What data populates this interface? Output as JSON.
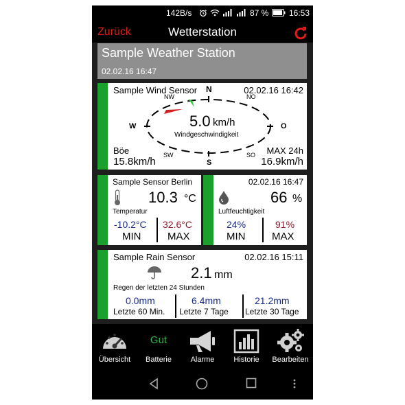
{
  "status_bar": {
    "net_speed": "142B/s",
    "battery_pct": "87 %",
    "time": "16:53"
  },
  "header": {
    "back_label": "Zurück",
    "title": "Wetterstation"
  },
  "station": {
    "name": "Sample Weather Station",
    "date": "02.02.16 16:47"
  },
  "wind": {
    "sensor_name": "Sample Wind Sensor",
    "timestamp": "02.02.16 16:42",
    "compass": {
      "n": "N",
      "ne": "NO",
      "e": "O",
      "se": "SO",
      "s": "S",
      "sw": "SW",
      "w": "W",
      "nw": "NW"
    },
    "speed_value": "5.0",
    "speed_unit": "km/h",
    "speed_label": "Windgeschwindigkeit",
    "gust_label": "Böe",
    "gust_value": "15.8km/h",
    "max_label": "MAX 24h",
    "max_value": "16.9km/h"
  },
  "temperature": {
    "sensor_name": "Sample Sensor Berlin",
    "value": "10.3",
    "unit": "°C",
    "label": "Temperatur",
    "min_value": "-10.2°C",
    "min_label": "MIN",
    "max_value": "32.6°C",
    "max_label": "MAX"
  },
  "humidity": {
    "timestamp": "02.02.16 16:47",
    "value": "66",
    "unit": "%",
    "label": "Luftfeuchtigkeit",
    "min_value": "24%",
    "min_label": "MIN",
    "max_value": "91%",
    "max_label": "MAX"
  },
  "rain": {
    "sensor_name": "Sample Rain Sensor",
    "timestamp": "02.02.16 15:11",
    "value": "2.1",
    "unit": "mm",
    "label": "Regen der letzten 24 Stunden",
    "periods": [
      {
        "value": "0.0mm",
        "label": "Letzte 60 Min."
      },
      {
        "value": "6.4mm",
        "label": "Letzte 7 Tage"
      },
      {
        "value": "21.2mm",
        "label": "Letzte 30 Tage"
      }
    ]
  },
  "bottom_nav": {
    "overview": "Übersicht",
    "battery_status": "Gut",
    "battery": "Batterie",
    "alarms": "Alarme",
    "history": "Historie",
    "edit": "Bearbeiten"
  },
  "colors": {
    "accent_green": "#1aa02c",
    "back_red": "#e21b1b",
    "min_blue": "#1a2a8a",
    "max_red": "#8b1a2a"
  }
}
